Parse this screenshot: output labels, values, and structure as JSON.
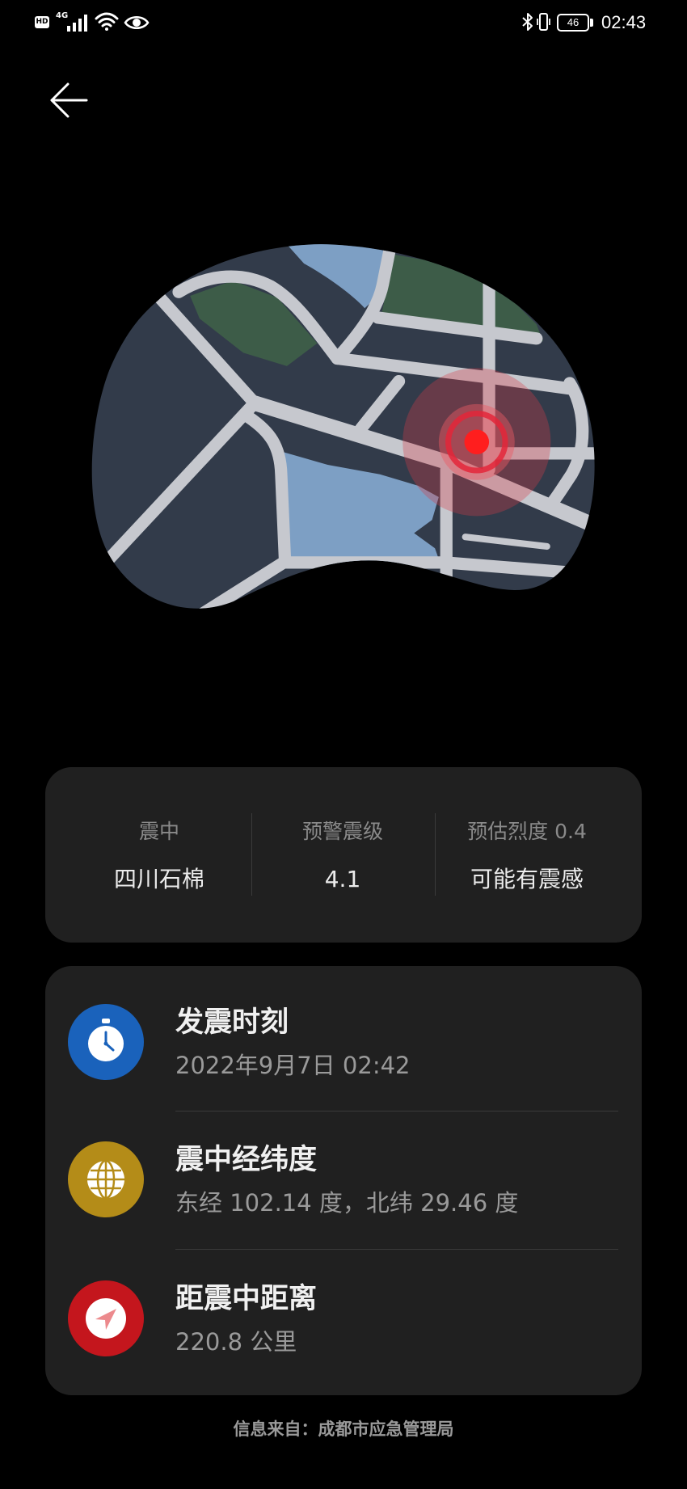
{
  "status_bar": {
    "hd_label": "HD",
    "network_label": "4G",
    "battery_level": "46",
    "time": "02:43",
    "icons": [
      "hd-icon",
      "cellular-signal-icon",
      "wifi-icon",
      "eye-comfort-icon",
      "bluetooth-icon",
      "vibrate-icon",
      "battery-icon"
    ]
  },
  "header": {
    "back_icon": "arrow-left-icon"
  },
  "summary": {
    "items": [
      {
        "label": "震中",
        "value": "四川石棉"
      },
      {
        "label": "预警震级",
        "value": "4.1"
      },
      {
        "label": "预估烈度 0.4",
        "value": "可能有震感"
      }
    ]
  },
  "details": {
    "items": [
      {
        "title": "发震时刻",
        "value": "2022年9月7日 02:42",
        "icon": "stopwatch-icon",
        "color": "#1a62bb"
      },
      {
        "title": "震中经纬度",
        "value": "东经 102.14 度，北纬 29.46 度",
        "icon": "globe-icon",
        "color": "#b48c18"
      },
      {
        "title": "距震中距离",
        "value": "220.8 公里",
        "icon": "navigation-arrow-icon",
        "color": "#c4161d"
      }
    ]
  },
  "footer": {
    "source": "信息来自：成都市应急管理局"
  },
  "colors": {
    "background": "#000000",
    "card": "#202020",
    "label": "#8a8a8a",
    "value": "#ececec",
    "epicenter_marker": "#ff1e1e",
    "map_land": "#323b4a",
    "map_road": "#c6c8ce",
    "map_water": "#7d9fc4",
    "map_park": "#3d5c48"
  }
}
